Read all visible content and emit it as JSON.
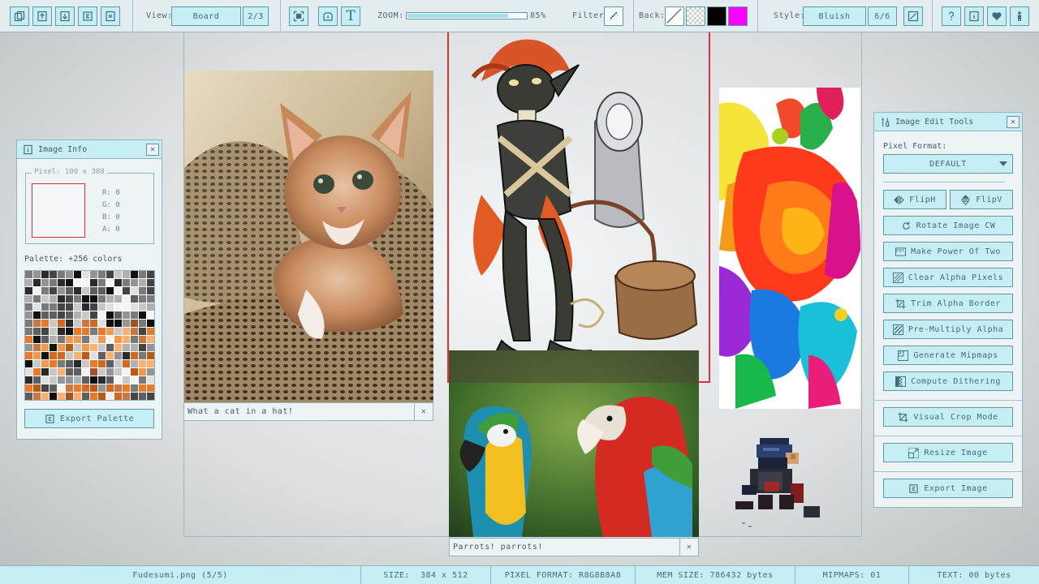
{
  "toolbar": {
    "view_label": "View:",
    "view_mode": "Board",
    "view_page": "2/3",
    "zoom_label": "ZOOM:",
    "zoom_value": "85%",
    "zoom_level_percent": 85,
    "filter_label": "Filter:",
    "back_label": "Back:",
    "style_label": "Style:",
    "style_value": "Bluish",
    "style_page": "6/6",
    "text_tool_glyph": "T",
    "back_colors": {
      "black": "#000000",
      "magenta": "#ff00ff"
    }
  },
  "image_info": {
    "title": "Image Info",
    "pixel_legend": "Pixel: 109 x 388",
    "r_line": "R: 0",
    "g_line": "G: 0",
    "b_line": "B: 0",
    "a_line": "A: 0",
    "palette_label": "Palette: +256 colors",
    "export_palette": "Export Palette"
  },
  "edit_tools": {
    "title": "Image Edit Tools",
    "pixel_format_label": "Pixel Format:",
    "pixel_format_value": "DEFAULT",
    "flip_h": "FlipH",
    "flip_v": "FlipV",
    "rotate": "Rotate Image CW",
    "pot": "Make Power Of Two",
    "pot_icon_text": "POT",
    "clear_alpha": "Clear Alpha Pixels",
    "trim_alpha": "Trim Alpha Border",
    "premultiply": "Pre-Multiply Alpha",
    "mipmaps": "Generate Mipmaps",
    "dithering": "Compute Dithering",
    "crop": "Visual Crop Mode",
    "resize": "Resize Image",
    "export": "Export Image"
  },
  "board": {
    "cat_caption": "What a cat in a hat!",
    "parrots_caption": "Parrots! parrots!"
  },
  "statusbar": {
    "file": "Fudesumi.png (5/5)",
    "size": "SIZE:  384 x 512",
    "format": "PIXEL FORMAT: R8G8B8A8",
    "mem": "MEM SIZE: 786432 bytes",
    "mipmaps": "MIPMAPS: 01",
    "text": "TEXT: 00 bytes"
  },
  "colors": {
    "accent": "#c8eef5",
    "border": "#5a9aaa",
    "panel": "#eef3f5",
    "selection": "#e0303c"
  }
}
